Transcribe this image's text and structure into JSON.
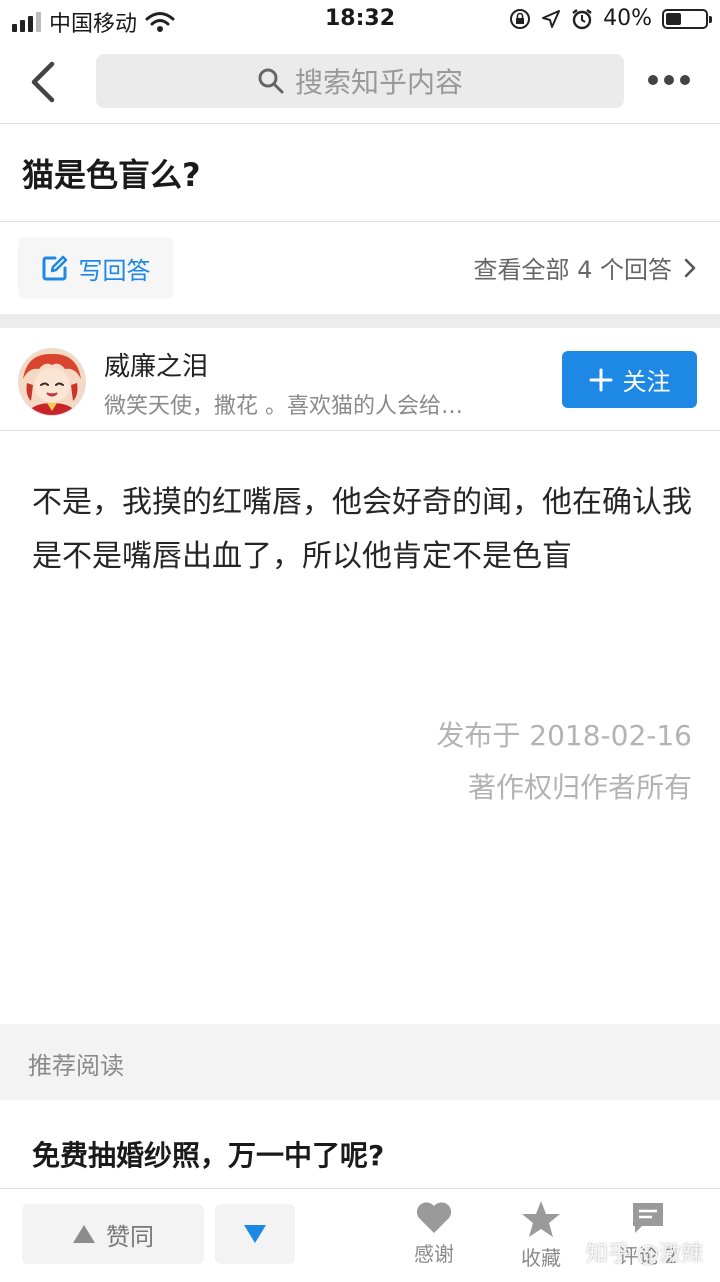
{
  "status_bar": {
    "carrier": "中国移动",
    "time": "18:32",
    "battery": "40%",
    "battery_level": 0.4
  },
  "nav": {
    "search_placeholder": "搜索知乎内容"
  },
  "question": {
    "title": "猫是色盲么?"
  },
  "actions": {
    "write_answer": "写回答",
    "view_all": "查看全部 4 个回答"
  },
  "author": {
    "name": "威廉之泪",
    "bio": "微笑天使，撒花 。喜欢猫的人会给…",
    "follow_label": "关注"
  },
  "answer": {
    "text": "不是，我摸的红嘴唇，他会好奇的闻，他在确认我是不是嘴唇出血了，所以他肯定不是色盲",
    "published": "发布于 2018-02-16",
    "copyright": "著作权归作者所有"
  },
  "recommend": {
    "label": "推荐阅读",
    "title": "免费抽婚纱照，万一中了呢?"
  },
  "bottom_bar": {
    "upvote": "赞同",
    "thanks": "感谢",
    "favorite": "收藏",
    "comment": "评论 2",
    "watermark": "知乎 @激辣"
  },
  "colors": {
    "accent": "#1e88e5",
    "muted_text": "#8a8a8a",
    "light_text": "#b3b3b3"
  },
  "icons": [
    "signal-icon",
    "wifi-icon",
    "lock-rotation-icon",
    "location-icon",
    "alarm-icon",
    "battery-icon",
    "back-arrow-icon",
    "search-icon",
    "more-icon",
    "edit-icon",
    "chevron-right-icon",
    "plus-icon",
    "upvote-triangle-icon",
    "downvote-triangle-icon",
    "heart-icon",
    "star-icon",
    "comment-icon"
  ]
}
